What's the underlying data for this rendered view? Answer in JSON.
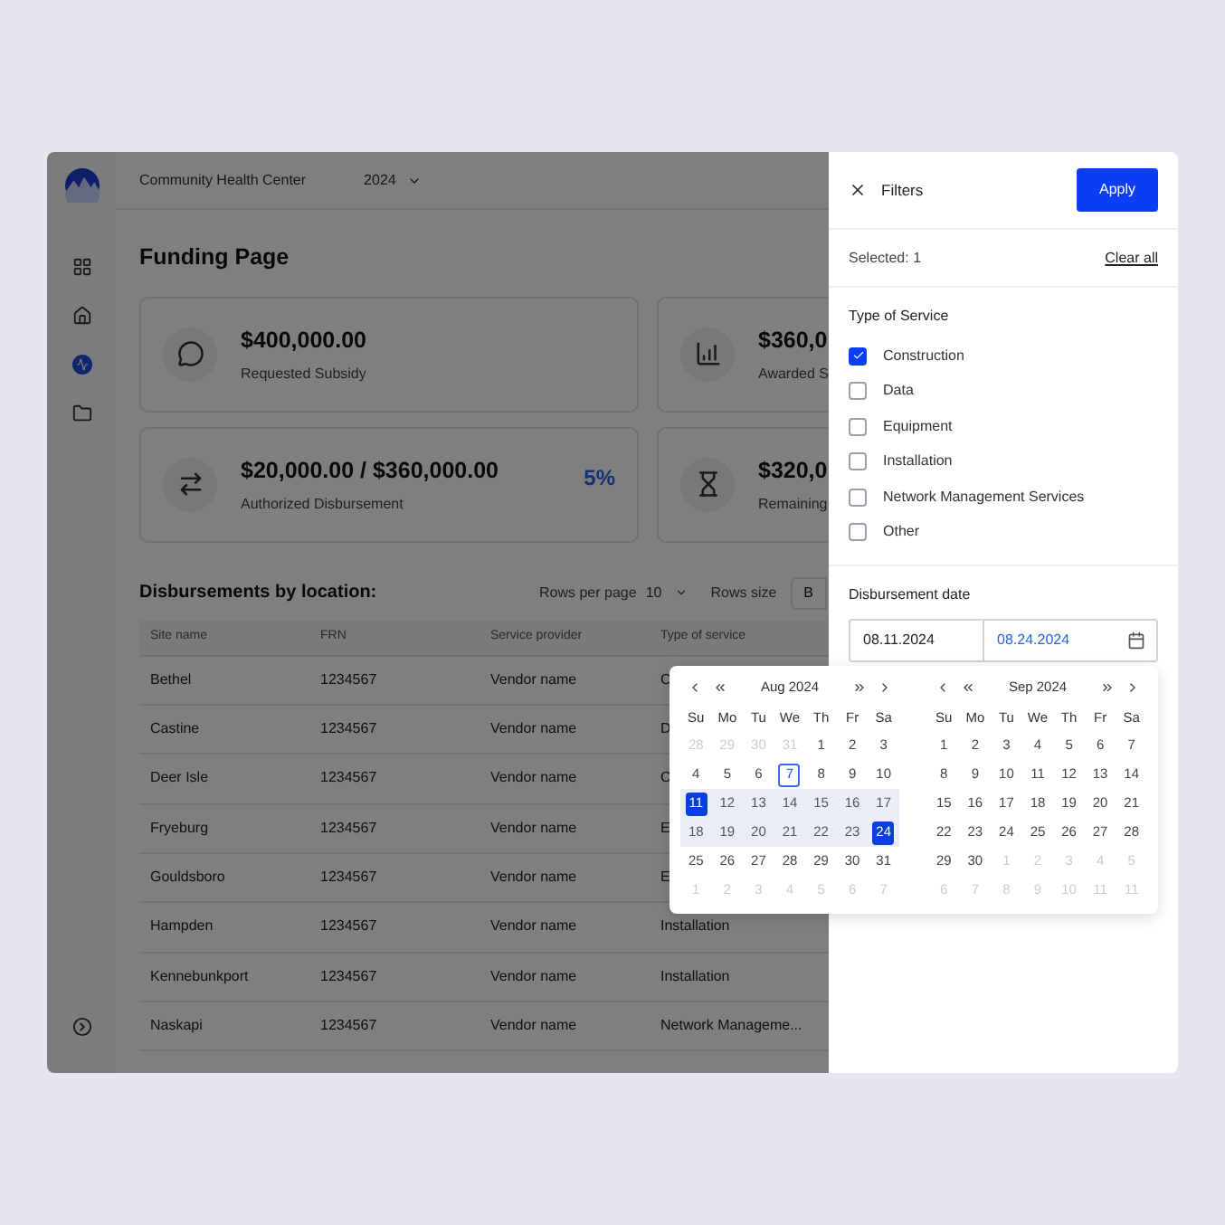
{
  "header": {
    "organization": "Community Health Center",
    "year": "2024"
  },
  "sidebar": {
    "items": [
      {
        "kind": "grid",
        "selected": false
      },
      {
        "kind": "home",
        "selected": false
      },
      {
        "kind": "activity",
        "selected": true
      },
      {
        "kind": "folder",
        "selected": false
      }
    ]
  },
  "page_title": "Funding Page",
  "cards": [
    {
      "kind": "chat",
      "amount": "$400,000.00",
      "label": "Requested Subsidy"
    },
    {
      "kind": "chart",
      "amount": "$360,0",
      "label": "Awarded S"
    },
    {
      "kind": "transfer",
      "amount": "$20,000.00 / $360,000.00",
      "label": "Authorized Disbursement",
      "percent": "5%"
    },
    {
      "kind": "hourglass",
      "amount": "$320,0",
      "label": "Remaining"
    }
  ],
  "table": {
    "title": "Disbursements by location:",
    "rows_per_page_label": "Rows per page",
    "rows_per_page": "10",
    "rows_size_label": "Rows size",
    "cut_button": "B",
    "columns": [
      "Site name",
      "FRN",
      "Service provider",
      "Type of service"
    ],
    "rows": [
      [
        "Bethel",
        "1234567",
        "Vendor name",
        "C"
      ],
      [
        "Castine",
        "1234567",
        "Vendor name",
        "D"
      ],
      [
        "Deer Isle",
        "1234567",
        "Vendor name",
        "C"
      ],
      [
        "Fryeburg",
        "1234567",
        "Vendor name",
        "E"
      ],
      [
        "Gouldsboro",
        "1234567",
        "Vendor name",
        "E"
      ],
      [
        "Hampden",
        "1234567",
        "Vendor name",
        "Installation"
      ],
      [
        "Kennebunkport",
        "1234567",
        "Vendor name",
        "Installation"
      ],
      [
        "Naskapi",
        "1234567",
        "Vendor name",
        "Network Manageme..."
      ]
    ]
  },
  "filters": {
    "title": "Filters",
    "apply": "Apply",
    "selected_label": "Selected:",
    "selected_count": "1",
    "clear_all": "Clear all",
    "type_title": "Type of Service",
    "options": [
      {
        "label": "Construction",
        "checked": true
      },
      {
        "label": "Data",
        "checked": false
      },
      {
        "label": "Equipment",
        "checked": false
      },
      {
        "label": "Installation",
        "checked": false
      },
      {
        "label": "Network Management Services",
        "checked": false
      },
      {
        "label": "Other",
        "checked": false
      }
    ],
    "date_title": "Disbursement date",
    "start": "08.11.2024",
    "end": "08.24.2024"
  },
  "calendar": {
    "months": [
      {
        "title": "Aug 2024",
        "weekdays": [
          "Su",
          "Mo",
          "Tu",
          "We",
          "Th",
          "Fr",
          "Sa"
        ],
        "weeks": [
          [
            {
              "d": "28",
              "kind": "out"
            },
            {
              "d": "29",
              "kind": "out"
            },
            {
              "d": "30",
              "kind": "out"
            },
            {
              "d": "31",
              "kind": "out"
            },
            {
              "d": "1",
              "kind": "day"
            },
            {
              "d": "2",
              "kind": "day"
            },
            {
              "d": "3",
              "kind": "day"
            }
          ],
          [
            {
              "d": "4",
              "kind": "day"
            },
            {
              "d": "5",
              "kind": "day"
            },
            {
              "d": "6",
              "kind": "day"
            },
            {
              "d": "7",
              "kind": "today"
            },
            {
              "d": "8",
              "kind": "day"
            },
            {
              "d": "9",
              "kind": "day"
            },
            {
              "d": "10",
              "kind": "day"
            }
          ],
          [
            {
              "d": "11",
              "kind": "end"
            },
            {
              "d": "12",
              "kind": "range"
            },
            {
              "d": "13",
              "kind": "range"
            },
            {
              "d": "14",
              "kind": "range"
            },
            {
              "d": "15",
              "kind": "range"
            },
            {
              "d": "16",
              "kind": "range"
            },
            {
              "d": "17",
              "kind": "range"
            }
          ],
          [
            {
              "d": "18",
              "kind": "range"
            },
            {
              "d": "19",
              "kind": "range"
            },
            {
              "d": "20",
              "kind": "range"
            },
            {
              "d": "21",
              "kind": "range"
            },
            {
              "d": "22",
              "kind": "range"
            },
            {
              "d": "23",
              "kind": "range"
            },
            {
              "d": "24",
              "kind": "end"
            }
          ],
          [
            {
              "d": "25",
              "kind": "day"
            },
            {
              "d": "26",
              "kind": "day"
            },
            {
              "d": "27",
              "kind": "day"
            },
            {
              "d": "28",
              "kind": "day"
            },
            {
              "d": "29",
              "kind": "day"
            },
            {
              "d": "30",
              "kind": "day"
            },
            {
              "d": "31",
              "kind": "day"
            }
          ],
          [
            {
              "d": "1",
              "kind": "out"
            },
            {
              "d": "2",
              "kind": "out"
            },
            {
              "d": "3",
              "kind": "out"
            },
            {
              "d": "4",
              "kind": "out"
            },
            {
              "d": "5",
              "kind": "out"
            },
            {
              "d": "6",
              "kind": "out"
            },
            {
              "d": "7",
              "kind": "out"
            }
          ]
        ]
      },
      {
        "title": "Sep 2024",
        "weekdays": [
          "Su",
          "Mo",
          "Tu",
          "We",
          "Th",
          "Fr",
          "Sa"
        ],
        "weeks": [
          [
            {
              "d": "1",
              "kind": "day"
            },
            {
              "d": "2",
              "kind": "day"
            },
            {
              "d": "3",
              "kind": "day"
            },
            {
              "d": "4",
              "kind": "day"
            },
            {
              "d": "5",
              "kind": "day"
            },
            {
              "d": "6",
              "kind": "day"
            },
            {
              "d": "7",
              "kind": "day"
            }
          ],
          [
            {
              "d": "8",
              "kind": "day"
            },
            {
              "d": "9",
              "kind": "day"
            },
            {
              "d": "10",
              "kind": "day"
            },
            {
              "d": "11",
              "kind": "day"
            },
            {
              "d": "12",
              "kind": "day"
            },
            {
              "d": "13",
              "kind": "day"
            },
            {
              "d": "14",
              "kind": "day"
            }
          ],
          [
            {
              "d": "15",
              "kind": "day"
            },
            {
              "d": "16",
              "kind": "day"
            },
            {
              "d": "17",
              "kind": "day"
            },
            {
              "d": "18",
              "kind": "day"
            },
            {
              "d": "19",
              "kind": "day"
            },
            {
              "d": "20",
              "kind": "day"
            },
            {
              "d": "21",
              "kind": "day"
            }
          ],
          [
            {
              "d": "22",
              "kind": "day"
            },
            {
              "d": "23",
              "kind": "day"
            },
            {
              "d": "24",
              "kind": "day"
            },
            {
              "d": "25",
              "kind": "day"
            },
            {
              "d": "26",
              "kind": "day"
            },
            {
              "d": "27",
              "kind": "day"
            },
            {
              "d": "28",
              "kind": "day"
            }
          ],
          [
            {
              "d": "29",
              "kind": "day"
            },
            {
              "d": "30",
              "kind": "day"
            },
            {
              "d": "1",
              "kind": "out"
            },
            {
              "d": "2",
              "kind": "out"
            },
            {
              "d": "3",
              "kind": "out"
            },
            {
              "d": "4",
              "kind": "out"
            },
            {
              "d": "5",
              "kind": "out"
            }
          ],
          [
            {
              "d": "6",
              "kind": "out"
            },
            {
              "d": "7",
              "kind": "out"
            },
            {
              "d": "8",
              "kind": "out"
            },
            {
              "d": "9",
              "kind": "out"
            },
            {
              "d": "10",
              "kind": "out"
            },
            {
              "d": "11",
              "kind": "out"
            },
            {
              "d": "11",
              "kind": "out"
            }
          ]
        ]
      }
    ]
  }
}
